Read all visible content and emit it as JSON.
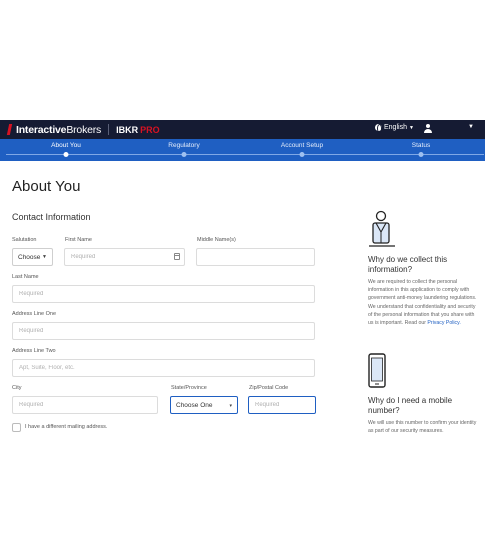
{
  "header": {
    "logo_interactive": "Interactive",
    "logo_brokers": "Brokers",
    "logo_ibkr": "IBKR",
    "logo_pro": "PRO",
    "language": "English"
  },
  "steps": [
    {
      "label": "About You",
      "active": true
    },
    {
      "label": "Regulatory",
      "active": false
    },
    {
      "label": "Account Setup",
      "active": false
    },
    {
      "label": "Status",
      "active": false
    }
  ],
  "page": {
    "title": "About You",
    "section_title": "Contact Information"
  },
  "form": {
    "salutation": {
      "label": "Salutation",
      "value": "Choose"
    },
    "first_name": {
      "label": "First Name",
      "placeholder": "Required"
    },
    "middle_name": {
      "label": "Middle Name(s)",
      "placeholder": ""
    },
    "last_name": {
      "label": "Last Name",
      "placeholder": "Required"
    },
    "address_line_one": {
      "label": "Address Line One",
      "placeholder": "Required"
    },
    "address_line_two": {
      "label": "Address Line Two",
      "placeholder": "Apt, Suite, Floor, etc."
    },
    "city": {
      "label": "City",
      "placeholder": "Required"
    },
    "state": {
      "label": "State/Province",
      "value": "Choose One"
    },
    "zip": {
      "label": "Zip/Postal Code",
      "placeholder": "Required"
    },
    "mailing_checkbox": {
      "label": "I have a different mailing address."
    }
  },
  "sidebar": {
    "why_collect_title": "Why do we collect this information?",
    "why_collect_text": "We are required to collect the personal information in this application to comply with government anti-money laundering regulations. We understand that confidentiality and security of the personal information that you share with us is important. Read our",
    "privacy_link": "Privacy Policy.",
    "why_mobile_title": "Why do I need a mobile number?",
    "why_mobile_text": "We will use this number to confirm your identity as part of our security measures."
  },
  "colors": {
    "topbar": "#151b33",
    "stepbar": "#1f5fc2",
    "brand_red": "#d81222",
    "focus_border": "#1f5fc2"
  }
}
